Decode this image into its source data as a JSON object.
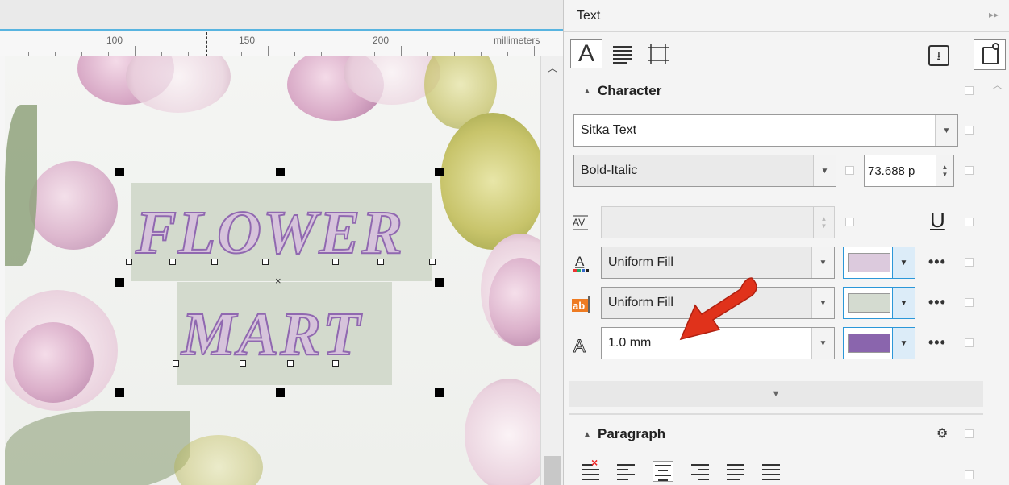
{
  "canvas": {
    "ruler": {
      "ticks": [
        "100",
        "150",
        "200"
      ],
      "unit": "millimeters"
    },
    "text_lines": [
      "FLOWER",
      "MART"
    ],
    "colors": {
      "text_fill": "#d6c3db",
      "outline": "#9068b0",
      "text_background": "#d3dacd",
      "ruler_accent": "#58b4e0"
    }
  },
  "panel": {
    "title": "Text",
    "tabs": [
      {
        "name": "character-tab",
        "icon": "character-A-icon"
      },
      {
        "name": "paragraph-tab",
        "icon": "paragraph-lines-icon"
      },
      {
        "name": "frame-tab",
        "icon": "frame-icon"
      }
    ],
    "character": {
      "header": "Character",
      "font_family": "Sitka Text",
      "font_style": "Bold-Italic",
      "font_size": "73.688 p",
      "kerning_value": "",
      "text_fill_type": "Uniform Fill",
      "text_fill_color": "#dccadd",
      "background_fill_type": "Uniform Fill",
      "background_fill_color": "#d4dbd0",
      "outline_width": "1.0 mm",
      "outline_color": "#8a65ad"
    },
    "more_label": "•••",
    "paragraph": {
      "header": "Paragraph"
    },
    "annotation_color": "#e0321b"
  }
}
